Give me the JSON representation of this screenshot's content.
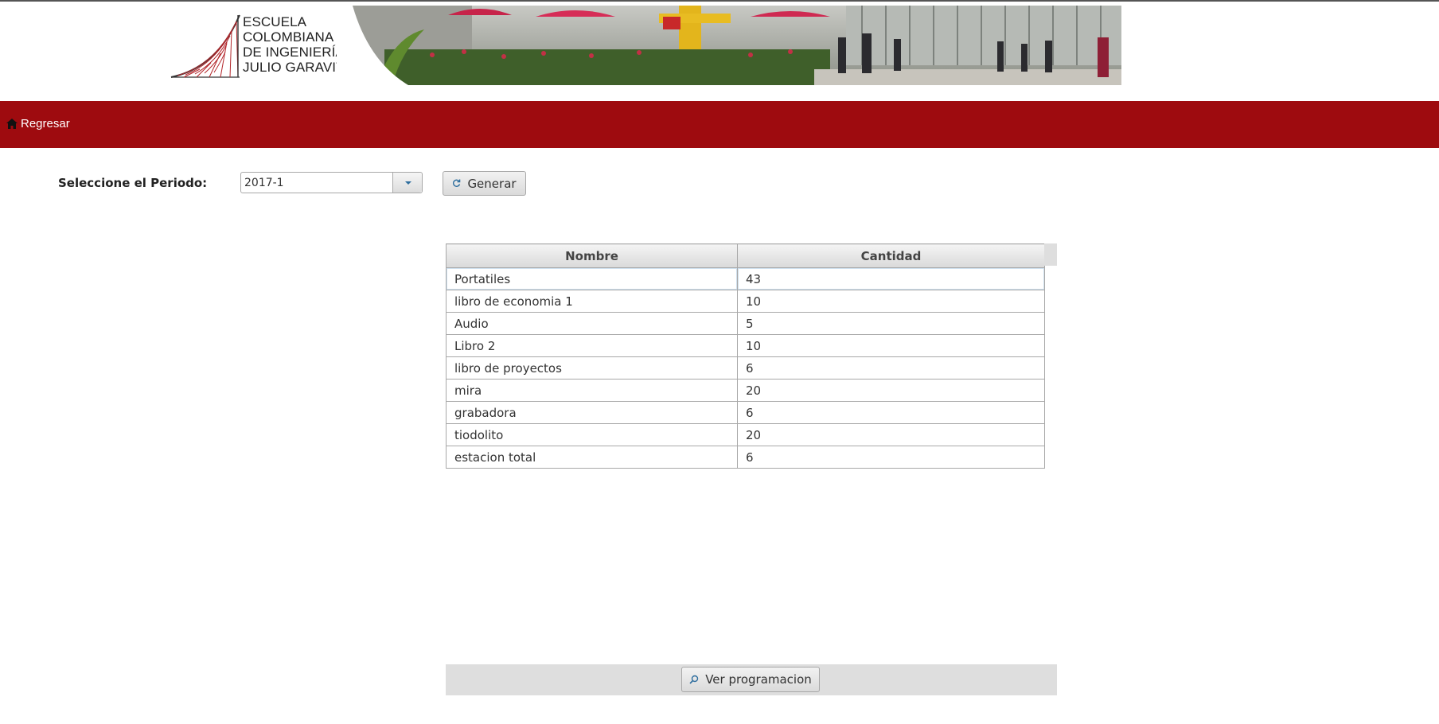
{
  "header": {
    "logo_lines": [
      "ESCUELA",
      "COLOMBIANA",
      "DE INGENIERÍA",
      "JULIO GARAVITO"
    ],
    "logo_icon": "escuela-logo-icon",
    "photo": "campus-photo"
  },
  "nav": {
    "home_icon": "home-icon",
    "back_label": "Regresar"
  },
  "form": {
    "period_label": "Seleccione el Periodo:",
    "period_value": "2017-1",
    "dropdown_icon": "chevron-down-icon",
    "generate_label": "Generar",
    "generate_icon": "refresh-icon"
  },
  "table": {
    "columns": [
      "Nombre",
      "Cantidad"
    ],
    "rows": [
      {
        "nombre": "Portatiles",
        "cantidad": "43"
      },
      {
        "nombre": "libro de economia 1",
        "cantidad": "10"
      },
      {
        "nombre": "Audio",
        "cantidad": "5"
      },
      {
        "nombre": "Libro 2",
        "cantidad": "10"
      },
      {
        "nombre": "libro de proyectos",
        "cantidad": "6"
      },
      {
        "nombre": "mira",
        "cantidad": "20"
      },
      {
        "nombre": "grabadora",
        "cantidad": "6"
      },
      {
        "nombre": "tiodolito",
        "cantidad": "20"
      },
      {
        "nombre": "estacion total",
        "cantidad": "6"
      }
    ]
  },
  "footer": {
    "view_label": "Ver programacion",
    "view_icon": "search-icon"
  },
  "colors": {
    "nav_bg": "#9e0b0f",
    "logo_red": "#b3262b"
  }
}
